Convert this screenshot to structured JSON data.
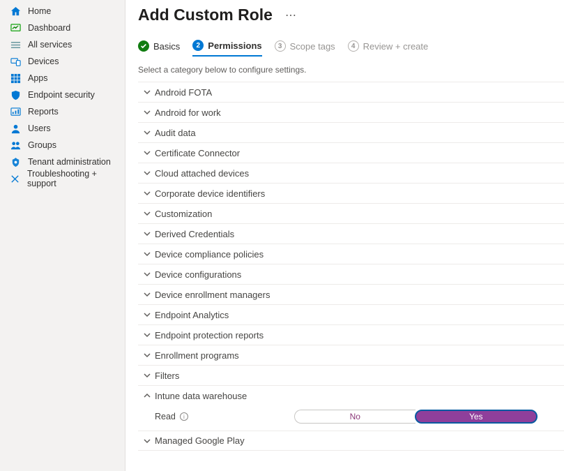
{
  "sidebar": {
    "items": [
      {
        "label": "Home",
        "icon": "home"
      },
      {
        "label": "Dashboard",
        "icon": "dashboard"
      },
      {
        "label": "All services",
        "icon": "list"
      },
      {
        "label": "Devices",
        "icon": "devices"
      },
      {
        "label": "Apps",
        "icon": "apps"
      },
      {
        "label": "Endpoint security",
        "icon": "shield"
      },
      {
        "label": "Reports",
        "icon": "reports"
      },
      {
        "label": "Users",
        "icon": "user"
      },
      {
        "label": "Groups",
        "icon": "group"
      },
      {
        "label": "Tenant administration",
        "icon": "tenant"
      },
      {
        "label": "Troubleshooting + support",
        "icon": "tools"
      }
    ]
  },
  "header": {
    "title": "Add Custom Role"
  },
  "steps": [
    {
      "label": "Basics",
      "state": "done"
    },
    {
      "num": "2",
      "label": "Permissions",
      "state": "current"
    },
    {
      "num": "3",
      "label": "Scope tags",
      "state": "pending"
    },
    {
      "num": "4",
      "label": "Review + create",
      "state": "pending"
    }
  ],
  "helper": "Select a category below to configure settings.",
  "categories": [
    {
      "label": "Android FOTA",
      "expanded": false
    },
    {
      "label": "Android for work",
      "expanded": false
    },
    {
      "label": "Audit data",
      "expanded": false
    },
    {
      "label": "Certificate Connector",
      "expanded": false
    },
    {
      "label": "Cloud attached devices",
      "expanded": false
    },
    {
      "label": "Corporate device identifiers",
      "expanded": false
    },
    {
      "label": "Customization",
      "expanded": false
    },
    {
      "label": "Derived Credentials",
      "expanded": false
    },
    {
      "label": "Device compliance policies",
      "expanded": false
    },
    {
      "label": "Device configurations",
      "expanded": false
    },
    {
      "label": "Device enrollment managers",
      "expanded": false
    },
    {
      "label": "Endpoint Analytics",
      "expanded": false
    },
    {
      "label": "Endpoint protection reports",
      "expanded": false
    },
    {
      "label": "Enrollment programs",
      "expanded": false
    },
    {
      "label": "Filters",
      "expanded": false
    },
    {
      "label": "Intune data warehouse",
      "expanded": true,
      "permission": {
        "label": "Read",
        "value": "Yes",
        "no": "No",
        "yes": "Yes"
      }
    },
    {
      "label": "Managed Google Play",
      "expanded": false
    }
  ]
}
